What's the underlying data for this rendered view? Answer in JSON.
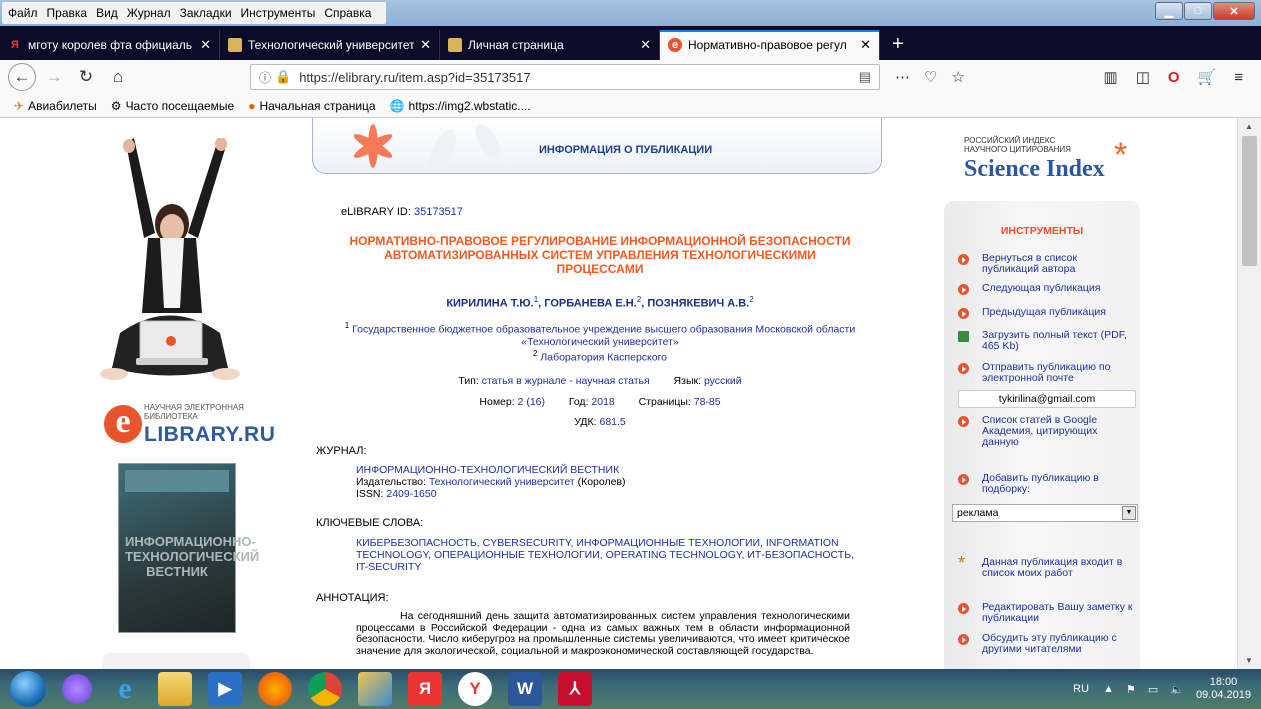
{
  "menubar": {
    "items": [
      "Файл",
      "Правка",
      "Вид",
      "Журнал",
      "Закладки",
      "Инструменты",
      "Справка"
    ],
    "window_buttons": [
      "minimize",
      "maximize",
      "close"
    ]
  },
  "tabs": [
    {
      "title": "мготу королев фта официаль",
      "favicon": "yandex-icon",
      "active": false
    },
    {
      "title": "Технологический университет",
      "favicon": "hat-icon",
      "active": false
    },
    {
      "title": "Личная страница",
      "favicon": "hat-icon",
      "active": false
    },
    {
      "title": "Нормативно-правовое регул",
      "favicon": "elibrary-icon",
      "active": true
    }
  ],
  "newtab_label": "+",
  "navbar": {
    "url": "https://elibrary.ru/item.asp?id=35173517"
  },
  "bookmarks": [
    {
      "label": "Авиабилеты",
      "icon": "plane-icon"
    },
    {
      "label": "Часто посещаемые",
      "icon": "gear-icon"
    },
    {
      "label": "Начальная страница",
      "icon": "firefox-icon"
    },
    {
      "label": "https://img2.wbstatic....",
      "icon": "globe-icon"
    }
  ],
  "left": {
    "logo_small": "НАУЧНАЯ ЭЛЕКТРОННАЯ БИБЛИОТЕКА",
    "logo_big": "LIBRARY.RU",
    "logo_letter": "e",
    "cover_title": "ИНФОРМАЦИОННО-ТЕХНОЛОГИЧЕСКИЙ ВЕСТНИК"
  },
  "center": {
    "banner_title": "ИНФОРМАЦИЯ О ПУБЛИКАЦИИ",
    "elib_id_label": "eLIBRARY ID:",
    "elib_id_value": "35173517",
    "title": "НОРМАТИВНО-ПРАВОВОЕ РЕГУЛИРОВАНИЕ ИНФОРМАЦИОННОЙ БЕЗОПАСНОСТИ АВТОМАТИЗИРОВАННЫХ СИСТЕМ УПРАВЛЕНИЯ ТЕХНОЛОГИЧЕСКИМИ ПРОЦЕССАМИ",
    "authors": [
      {
        "name": "КИРИЛИНА Т.Ю.",
        "sup": "1"
      },
      {
        "name": "ГОРБАНЕВА Е.Н.",
        "sup": "2"
      },
      {
        "name": "ПОЗНЯКЕВИЧ А.В.",
        "sup": "2"
      }
    ],
    "affil1_sup": "1",
    "affil1": "Государственное бюджетное образовательное учреждение высшего образования Московской области «Технологический университет»",
    "affil2_sup": "2",
    "affil2": "Лаборатория Касперского",
    "type_label": "Тип:",
    "type_value": "статья в журнале - научная статья",
    "lang_label": "Язык:",
    "lang_value": "русский",
    "number_label": "Номер:",
    "number_value": "2 (16)",
    "year_label": "Год:",
    "year_value": "2018",
    "pages_label": "Страницы:",
    "pages_value": "78-85",
    "udk_label": "УДК:",
    "udk_value": "681.5",
    "journal_head": "ЖУРНАЛ:",
    "journal_name": "ИНФОРМАЦИОННО-ТЕХНОЛОГИЧЕСКИЙ ВЕСТНИК",
    "publisher_label": "Издательство:",
    "publisher_value": "Технологический университет",
    "publisher_city": "(Королев)",
    "issn_label": "ISSN:",
    "issn_value": "2409-1650",
    "keywords_head": "КЛЮЧЕВЫЕ СЛОВА:",
    "keywords": "КИБЕРБЕЗОПАСНОСТЬ, CYBERSECURITY, ИНФОРМАЦИОННЫЕ ТЕХНОЛОГИИ, INFORMATION TECHNOLOGY, ОПЕРАЦИОННЫЕ ТЕХНОЛОГИИ, OPERATING TECHNOLOGY, ИТ-БЕЗОПАСНОСТЬ, IT-SECURITY",
    "abstract_head": "АННОТАЦИЯ:",
    "abstract": "На сегодняшний день защита автоматизированных систем управления технологическими процессами в Российской Федерации - одна из самых важных тем в области информационной безопасности. Число киберугроз на промышленные системы увеличиваются, что имеет критическое значение для экологической, социальной и макроэкономической составляющей государства."
  },
  "right": {
    "rsci_small": "РОССИЙСКИЙ ИНДЕКС НАУЧНОГО ЦИТИРОВАНИЯ",
    "rsci_big": "Science Index",
    "tools_head": "ИНСТРУМЕНТЫ",
    "items": [
      "Вернуться в список публикаций автора",
      "Следующая публикация",
      "Предыдущая публикация",
      "Загрузить полный текст (PDF, 465 Kb)",
      "Отправить публикацию по электронной почте",
      "Список статей в Google Академия, цитирующих данную",
      "Добавить публикацию в подборку:",
      "Данная публикация входит в список моих работ",
      "Редактировать Вашу заметку к публикации",
      "Обсудить эту публикацию с другими читателями"
    ],
    "email": "tykirilina@gmail.com",
    "select_value": "реклама"
  },
  "taskbar": {
    "lang": "RU",
    "time": "18:00",
    "date": "09.04.2019"
  },
  "colors": {
    "accent_orange": "#f25a1f",
    "link_blue": "#1a31a0",
    "tab_active_line": "#0a84ff"
  }
}
